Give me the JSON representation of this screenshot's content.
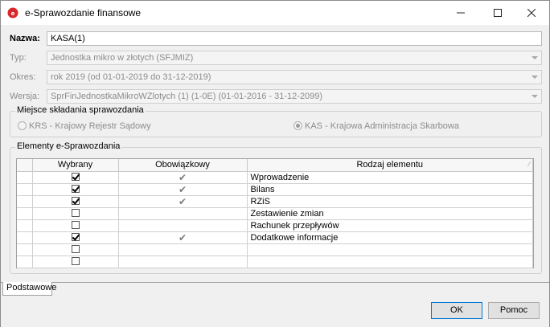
{
  "window": {
    "title": "e-Sprawozdanie finansowe"
  },
  "form": {
    "nazwa": {
      "label": "Nazwa:",
      "value": "KASA(1)"
    },
    "typ": {
      "label": "Typ:",
      "value": "Jednostka mikro w złotych (SFJMIZ)"
    },
    "okres": {
      "label": "Okres:",
      "value": "rok 2019 (od 01-01-2019 do 31-12-2019)"
    },
    "wersja": {
      "label": "Wersja:",
      "value": "SprFinJednostkaMikroWZlotych (1) (1-0E) (01-01-2016 - 31-12-2099)"
    }
  },
  "place_group": {
    "title": "Miejsce składania sprawozdania",
    "options": [
      {
        "label": "KRS - Krajowy Rejestr Sądowy",
        "selected": false
      },
      {
        "label": "KAS - Krajowa Administracja Skarbowa",
        "selected": true
      }
    ]
  },
  "elements_group": {
    "title": "Elementy e-Sprawozdania",
    "columns": [
      "Wybrany",
      "Obowiązkowy",
      "Rodzaj elementu"
    ],
    "rows": [
      {
        "wybrany": true,
        "obowiazkowy": true,
        "rodzaj": "Wprowadzenie"
      },
      {
        "wybrany": true,
        "obowiazkowy": true,
        "rodzaj": "Bilans"
      },
      {
        "wybrany": true,
        "obowiazkowy": true,
        "rodzaj": "RZiS"
      },
      {
        "wybrany": false,
        "obowiazkowy": false,
        "rodzaj": "Zestawienie zmian"
      },
      {
        "wybrany": false,
        "obowiazkowy": false,
        "rodzaj": "Rachunek przepływów"
      },
      {
        "wybrany": true,
        "obowiazkowy": true,
        "rodzaj": "Dodatkowe informacje"
      },
      {
        "wybrany": false,
        "obowiazkowy": false,
        "rodzaj": ""
      },
      {
        "wybrany": false,
        "obowiazkowy": false,
        "rodzaj": ""
      }
    ]
  },
  "tabs": {
    "podstawowe": "Podstawowe"
  },
  "buttons": {
    "ok": "OK",
    "help": "Pomoc"
  }
}
